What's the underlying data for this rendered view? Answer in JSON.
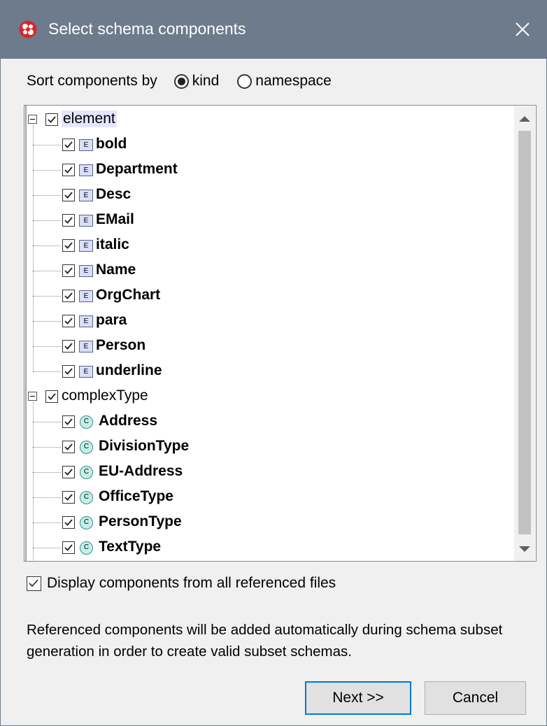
{
  "window": {
    "title": "Select schema components",
    "accent_color": "#6d7b8c"
  },
  "sort": {
    "label": "Sort components by",
    "options": [
      {
        "label": "kind",
        "selected": true
      },
      {
        "label": "namespace",
        "selected": false
      }
    ]
  },
  "tree": {
    "groups": [
      {
        "label": "element",
        "checked": true,
        "badge": "E",
        "items": [
          "bold",
          "Department",
          "Desc",
          "EMail",
          "italic",
          "Name",
          "OrgChart",
          "para",
          "Person",
          "underline"
        ]
      },
      {
        "label": "complexType",
        "checked": true,
        "badge": "C",
        "items": [
          "Address",
          "DivisionType",
          "EU-Address",
          "OfficeType",
          "PersonType",
          "TextType"
        ]
      }
    ]
  },
  "display_all": {
    "label": "Display components from all referenced files",
    "checked": true
  },
  "info_text": "Referenced components will be added automatically during schema subset generation in order to create valid subset schemas.",
  "buttons": {
    "next": "Next >>",
    "cancel": "Cancel"
  }
}
